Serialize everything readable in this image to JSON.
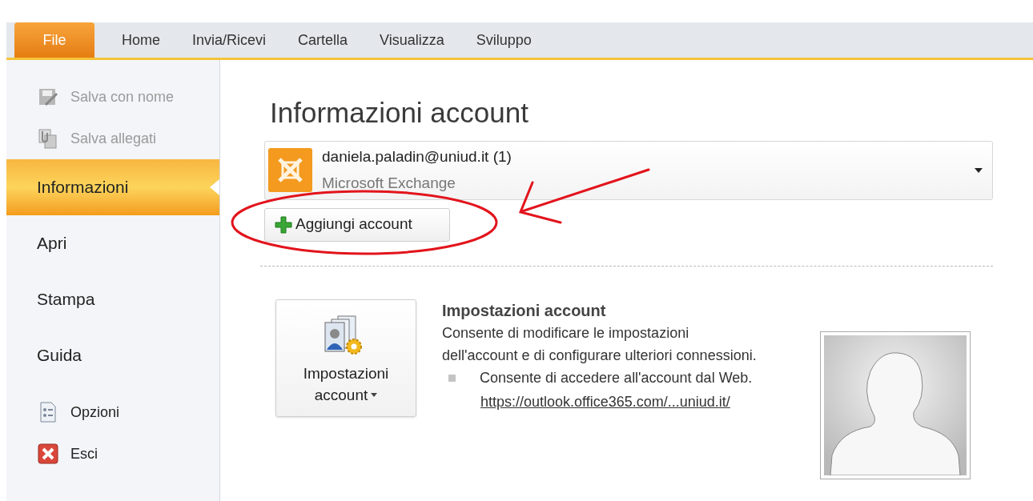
{
  "tabs": [
    {
      "label": "File",
      "selected": true
    },
    {
      "label": "Home",
      "selected": false
    },
    {
      "label": "Invia/Ricevi",
      "selected": false
    },
    {
      "label": "Cartella",
      "selected": false
    },
    {
      "label": "Visualizza",
      "selected": false
    },
    {
      "label": "Sviluppo",
      "selected": false
    }
  ],
  "sidebar": {
    "items": [
      {
        "label": "Salva con nome",
        "kind": "command",
        "disabled": true,
        "selected": false
      },
      {
        "label": "Salva allegati",
        "kind": "command",
        "disabled": true,
        "selected": false
      },
      {
        "label": "Informazioni",
        "kind": "page",
        "disabled": false,
        "selected": true
      },
      {
        "label": "Apri",
        "kind": "page",
        "disabled": false,
        "selected": false
      },
      {
        "label": "Stampa",
        "kind": "page",
        "disabled": false,
        "selected": false
      },
      {
        "label": "Guida",
        "kind": "page",
        "disabled": false,
        "selected": false
      },
      {
        "label": "Opzioni",
        "kind": "command",
        "disabled": false,
        "selected": false
      },
      {
        "label": "Esci",
        "kind": "command",
        "disabled": false,
        "selected": false
      }
    ]
  },
  "main": {
    "title": "Informazioni account",
    "account": {
      "email": "daniela.paladin@uniud.it (1)",
      "type": "Microsoft Exchange"
    },
    "add_button": "Aggiungi account",
    "settings": {
      "button_line_1": "Impostazioni",
      "button_line_2": "account",
      "heading": "Impostazioni account",
      "description": "Consente di modificare le impostazioni dell'account e di configurare ulteriori connessioni.",
      "bullet": "Consente di accedere all'account dal Web.",
      "link": "https://outlook.office365.com/...uniud.it/"
    }
  }
}
